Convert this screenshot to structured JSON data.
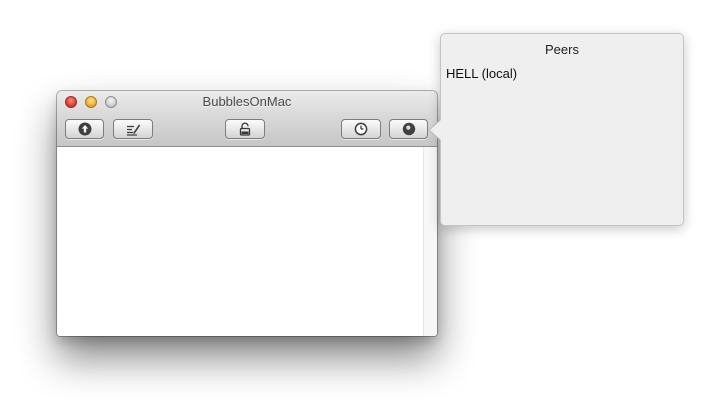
{
  "window": {
    "title": "BubblesOnMac",
    "traffic_lights": {
      "close": "#e0443a",
      "minimize": "#f1b535",
      "zoom": "#cfcfcf"
    },
    "toolbar": {
      "buttons": [
        {
          "icon": "up-arrow-circle-icon"
        },
        {
          "icon": "compose-pencil-icon"
        },
        {
          "icon": "padlock-icon"
        },
        {
          "icon": "clock-icon"
        },
        {
          "icon": "peers-circle-icon"
        }
      ]
    }
  },
  "popover": {
    "title": "Peers",
    "peers": [
      {
        "label": "HELL (local)"
      }
    ]
  }
}
